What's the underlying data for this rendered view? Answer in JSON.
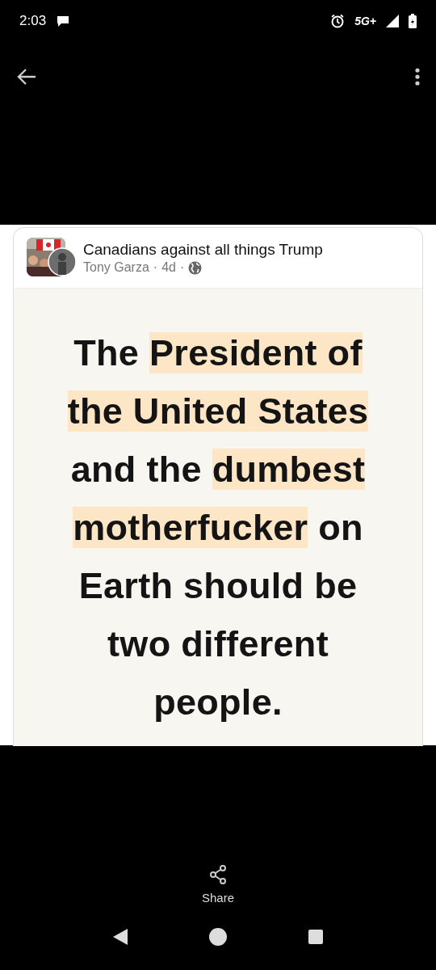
{
  "status_bar": {
    "time": "2:03",
    "network": "5G+"
  },
  "post": {
    "group": "Canadians against all things Trump",
    "author": "Tony Garza",
    "separator_1": "·",
    "age": "4d",
    "separator_2": "·",
    "meme_lines": [
      [
        {
          "text": "The ",
          "highlighted": false
        },
        {
          "text": "President of",
          "highlighted": true
        }
      ],
      [
        {
          "text": "the United States",
          "highlighted": true
        }
      ],
      [
        {
          "text": "and the ",
          "highlighted": false
        },
        {
          "text": "dumbest",
          "highlighted": true
        }
      ],
      [
        {
          "text": "motherfucker",
          "highlighted": true
        },
        {
          "text": " on",
          "highlighted": false
        }
      ],
      [
        {
          "text": "Earth should be",
          "highlighted": false
        }
      ],
      [
        {
          "text": "two different",
          "highlighted": false
        }
      ],
      [
        {
          "text": "people.",
          "highlighted": false
        }
      ]
    ]
  },
  "actions": [
    {
      "label": "Share"
    }
  ]
}
